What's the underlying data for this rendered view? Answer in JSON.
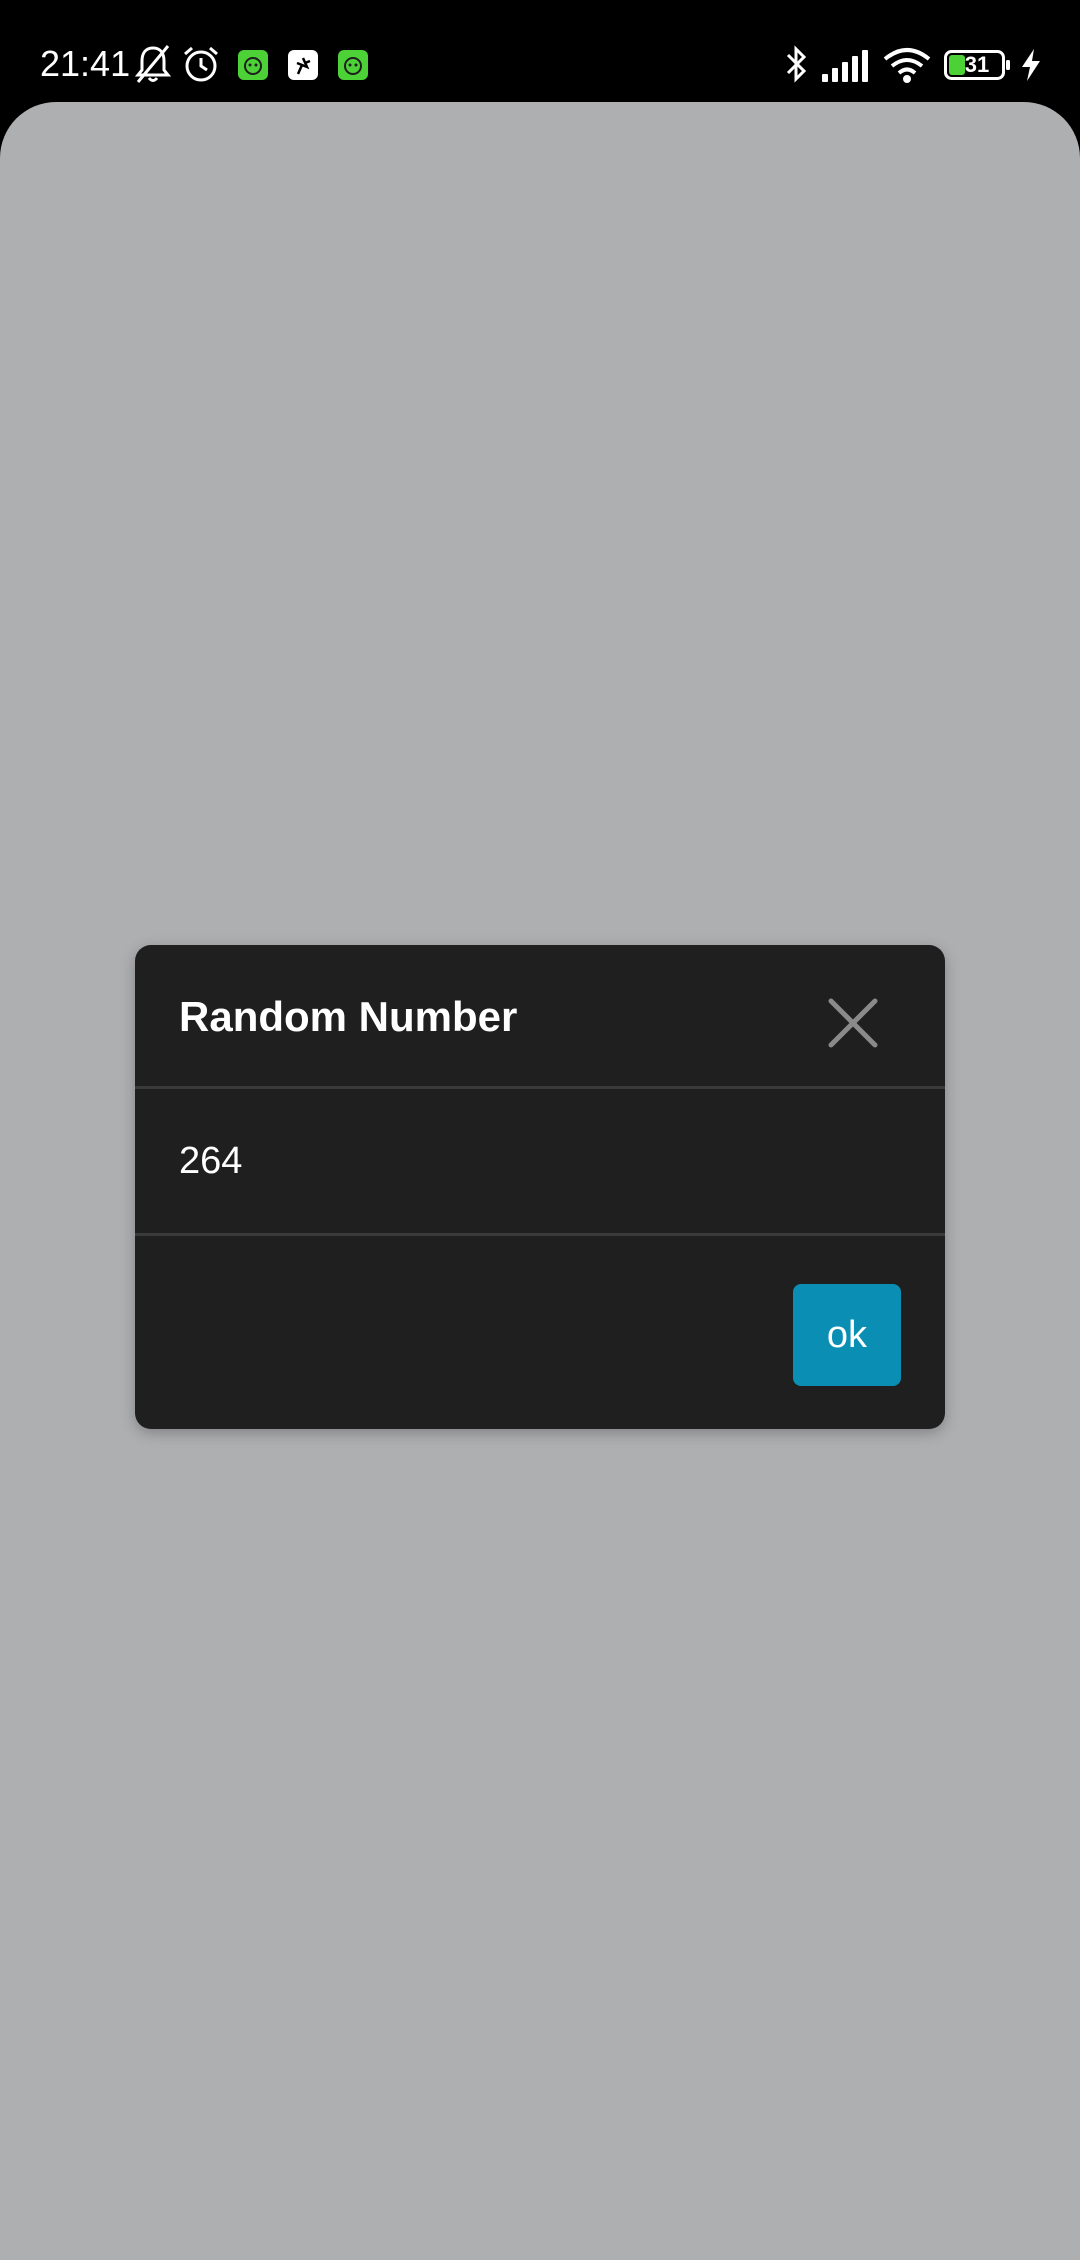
{
  "status_bar": {
    "time": "21:41",
    "battery_level": "31",
    "left_icons": [
      "bell-off-icon",
      "alarm-icon",
      "app-notification-icon",
      "sport-app-icon",
      "app-notification-icon"
    ],
    "right_icons": [
      "bluetooth-icon",
      "signal-icon",
      "wifi-icon",
      "battery-icon",
      "charging-icon"
    ],
    "battery_color": "#4cd137"
  },
  "dialog": {
    "title": "Random Number",
    "value": "264",
    "ok_label": "ok",
    "close_icon": "close-icon",
    "accent_color": "#0b8eb3"
  }
}
